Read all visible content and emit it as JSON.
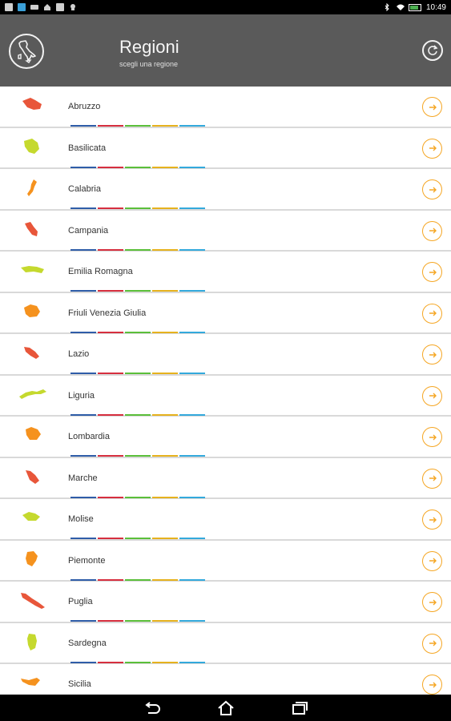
{
  "status_bar": {
    "time": "10:49",
    "left_icons": [
      "notification-icon",
      "app-icon",
      "image-icon",
      "home-app-icon",
      "file-icon",
      "android-icon"
    ],
    "right_icons": [
      "bluetooth-icon",
      "wifi-icon",
      "battery-icon"
    ]
  },
  "header": {
    "title": "Regioni",
    "subtitle": "scegli una regione",
    "logo_icon": "italy-map-icon",
    "refresh_icon": "refresh-icon",
    "background": "#5a5a5a"
  },
  "colors": {
    "accent": "#f5a623",
    "bar_colors": [
      "#2f5da8",
      "#d62f3f",
      "#5bbf3a",
      "#e6b21e",
      "#33a9dc"
    ],
    "region_colors": {
      "red": "#e8563a",
      "lime": "#c5d92e",
      "orange": "#f5921e"
    }
  },
  "regions": [
    {
      "name": "Abruzzo",
      "color": "#e8563a"
    },
    {
      "name": "Basilicata",
      "color": "#c5d92e"
    },
    {
      "name": "Calabria",
      "color": "#f5921e"
    },
    {
      "name": "Campania",
      "color": "#e8563a"
    },
    {
      "name": "Emilia Romagna",
      "color": "#c5d92e"
    },
    {
      "name": "Friuli Venezia Giulia",
      "color": "#f5921e"
    },
    {
      "name": "Lazio",
      "color": "#e8563a"
    },
    {
      "name": "Liguria",
      "color": "#c5d92e"
    },
    {
      "name": "Lombardia",
      "color": "#f5921e"
    },
    {
      "name": "Marche",
      "color": "#e8563a"
    },
    {
      "name": "Molise",
      "color": "#c5d92e"
    },
    {
      "name": "Piemonte",
      "color": "#f5921e"
    },
    {
      "name": "Puglia",
      "color": "#e8563a"
    },
    {
      "name": "Sardegna",
      "color": "#c5d92e"
    },
    {
      "name": "Sicilia",
      "color": "#f5921e"
    }
  ],
  "navbar": {
    "icons": [
      "back-icon",
      "home-icon",
      "recent-apps-icon"
    ]
  }
}
